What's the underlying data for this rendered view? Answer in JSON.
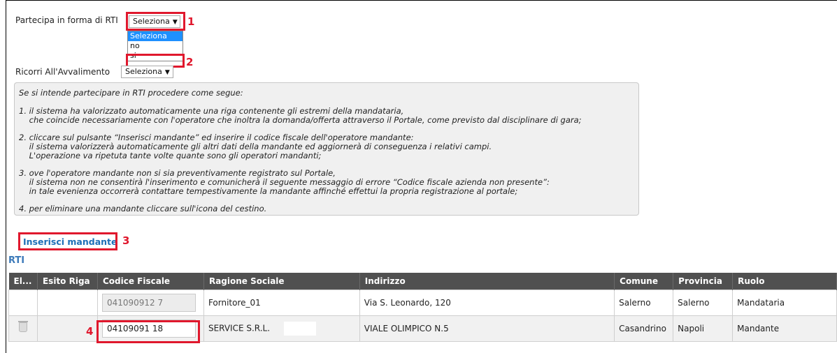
{
  "form": {
    "rti_label": "Partecipa in forma di RTI",
    "rti_select_value": "Seleziona",
    "rti_options": [
      "Seleziona",
      "no",
      "si"
    ],
    "avvalimento_label": "Ricorri All'Avvalimento",
    "avvalimento_select_value": "Seleziona"
  },
  "annotations": [
    "1",
    "2",
    "3",
    "4"
  ],
  "info": {
    "heading": "Se si intende partecipare in RTI procedere come segue:",
    "steps": [
      "1. il sistema ha valorizzato automaticamente una riga contenente gli estremi della mandataria,\n    che coincide necessariamente con l'operatore che inoltra la domanda/offerta attraverso il Portale, come previsto dal disciplinare di gara;",
      "2. cliccare sul pulsante “Inserisci mandante” ed inserire il codice fiscale dell'operatore mandante:\n    il sistema valorizzerà automaticamente gli altri dati della mandante ed aggiornerà di conseguenza i relativi campi.\n    L'operazione va ripetuta tante volte quante sono gli operatori mandanti;",
      "3. ove l'operatore mandante non si sia preventivamente registrato sul Portale,\n    il sistema non ne consentirà l'inserimento e comunicherà il seguente messaggio di errore “Codice fiscale azienda non presente”:\n    in tale evenienza occorrerà contattare tempestivamente la mandante affinché effettui la propria registrazione al portale;",
      "4. per eliminare una mandante cliccare sull'icona del cestino."
    ]
  },
  "insert_button": "Inserisci mandante",
  "section_title": "RTI",
  "table": {
    "headers": [
      "El...",
      "Esito Riga",
      "Codice Fiscale",
      "Ragione Sociale",
      "Indirizzo",
      "Comune",
      "Provincia",
      "Ruolo"
    ],
    "rows": [
      {
        "codice_fiscale": "041090912 7",
        "ragione_sociale": "Fornitore_01",
        "indirizzo": "Via S. Leonardo, 120",
        "comune": "Salerno",
        "provincia": "Salerno",
        "ruolo": "Mandataria"
      },
      {
        "codice_fiscale": "04109091 18",
        "ragione_sociale": "SERVICE S.R.L.",
        "indirizzo": "VIALE OLIMPICO N.5",
        "comune": "Casandrino",
        "provincia": "Napoli",
        "ruolo": "Mandante"
      }
    ]
  },
  "colors": {
    "annotation_red": "#e0182d",
    "link_blue": "#1c6fb7",
    "header_gray": "#505050",
    "select_highlight": "#1e90ff"
  },
  "icons": [
    "dropdown-arrow-icon",
    "trash-icon"
  ]
}
